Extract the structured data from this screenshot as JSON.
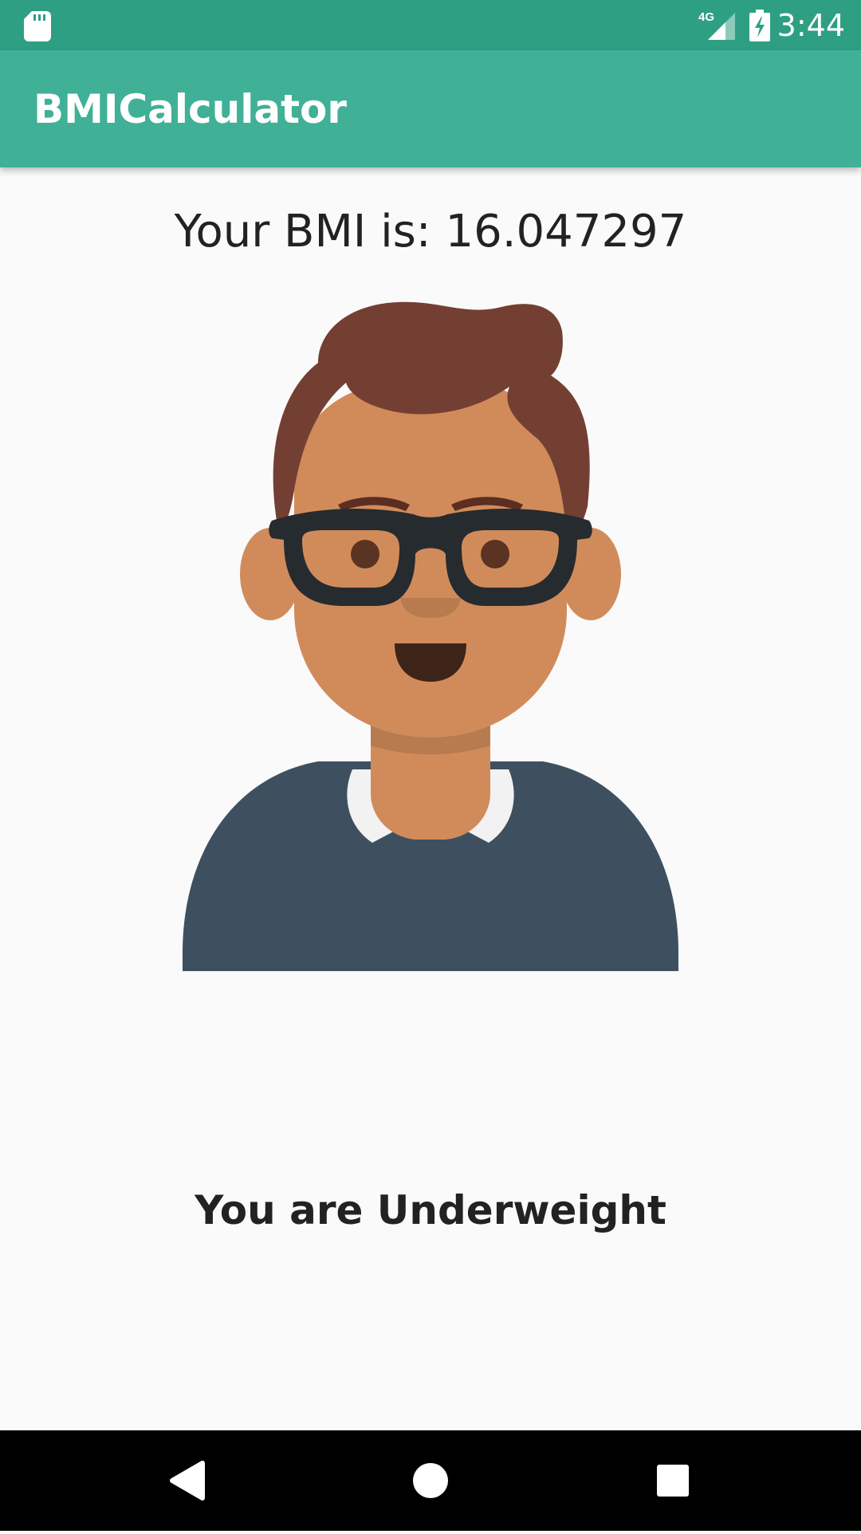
{
  "status_bar": {
    "time": "3:44",
    "network": "4G",
    "icons": [
      "sd-card-icon",
      "signal-icon",
      "battery-charging-icon"
    ],
    "color": "#2f9f84"
  },
  "app_bar": {
    "title": "BMICalculator",
    "color": "#40b097"
  },
  "main": {
    "bmi_text": "Your BMI is: 16.047297",
    "avatar_icon": "man-avatar-glasses-icon",
    "result_text": "You are Underweight"
  },
  "nav_bar": {
    "buttons": [
      "back-icon",
      "home-icon",
      "recents-icon"
    ]
  }
}
